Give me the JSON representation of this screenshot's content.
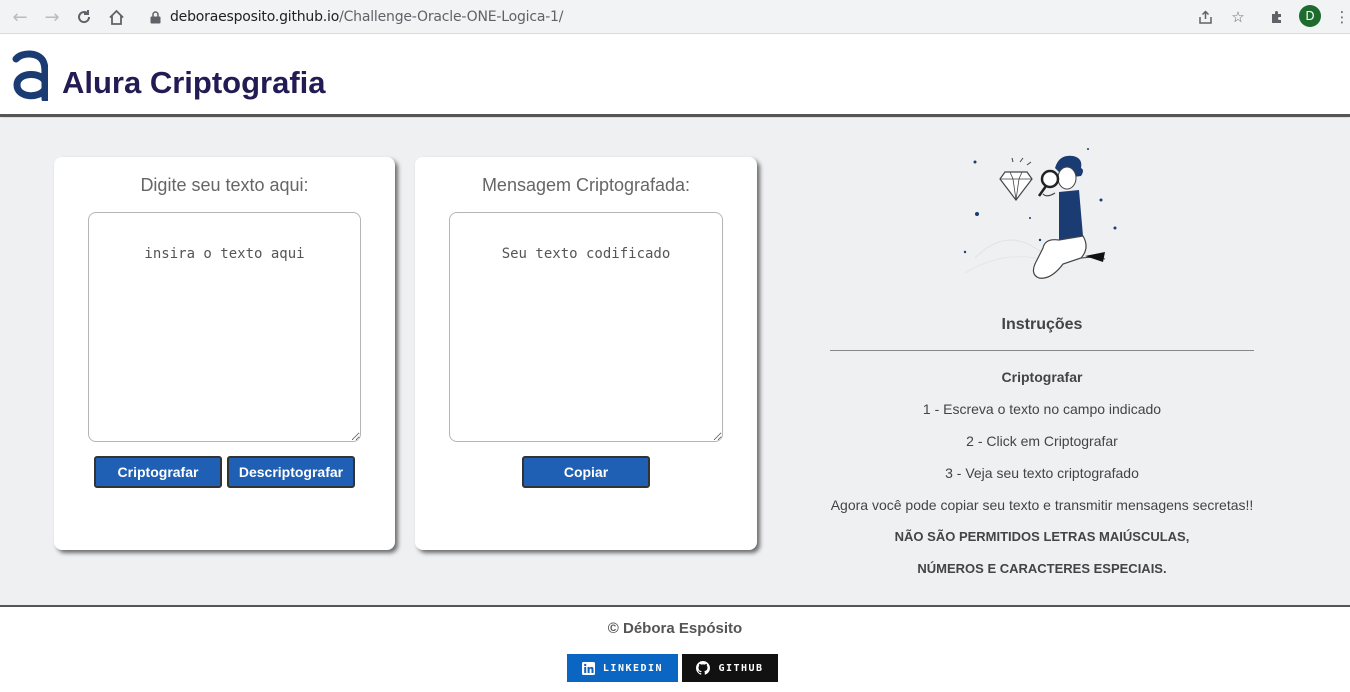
{
  "browser": {
    "url_host": "deboraesposito.github.io",
    "url_path": "/Challenge-Oracle-ONE-Logica-1/",
    "profile_initial": "D"
  },
  "header": {
    "title": "Alura Criptografia",
    "logo_color": "#1b3b73",
    "title_color": "#231b54"
  },
  "encrypt_card": {
    "title": "Digite seu texto aqui:",
    "placeholder": "insira o texto aqui",
    "encrypt_label": "Criptografar",
    "decrypt_label": "Descriptografar"
  },
  "output_card": {
    "title": "Mensagem Criptografada:",
    "placeholder": "Seu texto codificado",
    "copy_label": "Copiar"
  },
  "instructions": {
    "title": "Instruções",
    "section_title": "Criptografar",
    "steps": [
      "1 - Escreva o texto no campo indicado",
      "2 - Click em Criptografar",
      "3 - Veja seu texto criptografado"
    ],
    "note": "Agora você pode copiar seu texto e transmitir mensagens secretas!!",
    "warning_1": "NÃO SÃO PERMITIDOS LETRAS MAIÚSCULAS,",
    "warning_2": "NÚMEROS E CARACTERES ESPECIAIS."
  },
  "footer": {
    "copyright": "© Débora Espósito",
    "linkedin_label": "LINKEDIN",
    "github_label": "GITHUB",
    "linkedin_color": "#0a66c2",
    "github_color": "#111111"
  },
  "colors": {
    "button_blue": "#1f5fb4",
    "page_bg": "#eff0f2"
  }
}
